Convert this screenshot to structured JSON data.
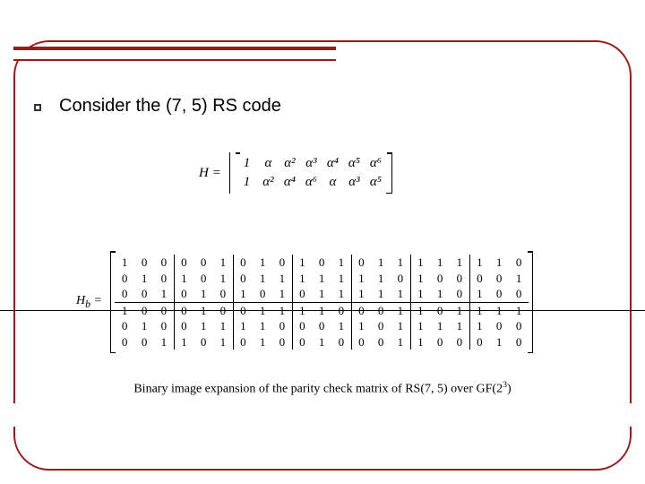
{
  "headline": "Consider the (7, 5) RS code",
  "matrixH": {
    "label": "H =",
    "rows": [
      [
        "1",
        "α",
        "α²",
        "α³",
        "α⁴",
        "α⁵",
        "α⁶"
      ],
      [
        "1",
        "α²",
        "α⁴",
        "α⁶",
        "α",
        "α³",
        "α⁵"
      ]
    ]
  },
  "matrixHb": {
    "label": "H_b =",
    "block_cols": 7,
    "block_size": 3,
    "rows": [
      [
        1,
        0,
        0,
        0,
        0,
        1,
        0,
        1,
        0,
        1,
        0,
        1,
        0,
        1,
        1,
        1,
        1,
        1,
        1,
        1,
        0
      ],
      [
        0,
        1,
        0,
        1,
        0,
        1,
        0,
        1,
        1,
        1,
        1,
        1,
        1,
        1,
        0,
        1,
        0,
        0,
        0,
        0,
        1
      ],
      [
        0,
        0,
        1,
        0,
        1,
        0,
        1,
        0,
        1,
        0,
        1,
        1,
        1,
        1,
        1,
        1,
        1,
        0,
        1,
        0,
        0
      ],
      [
        1,
        0,
        0,
        0,
        1,
        0,
        0,
        1,
        1,
        1,
        1,
        0,
        0,
        0,
        1,
        1,
        0,
        1,
        1,
        1,
        1
      ],
      [
        0,
        1,
        0,
        0,
        1,
        1,
        1,
        1,
        0,
        0,
        0,
        1,
        1,
        0,
        1,
        1,
        1,
        1,
        1,
        0,
        0
      ],
      [
        0,
        0,
        1,
        1,
        0,
        1,
        0,
        1,
        0,
        0,
        1,
        0,
        0,
        0,
        1,
        1,
        0,
        0,
        0,
        1,
        0
      ]
    ]
  },
  "caption_prefix": "Binary image expansion of the parity check matrix of RS(7, 5) over GF(2",
  "caption_sup": "3",
  "caption_suffix": ")"
}
